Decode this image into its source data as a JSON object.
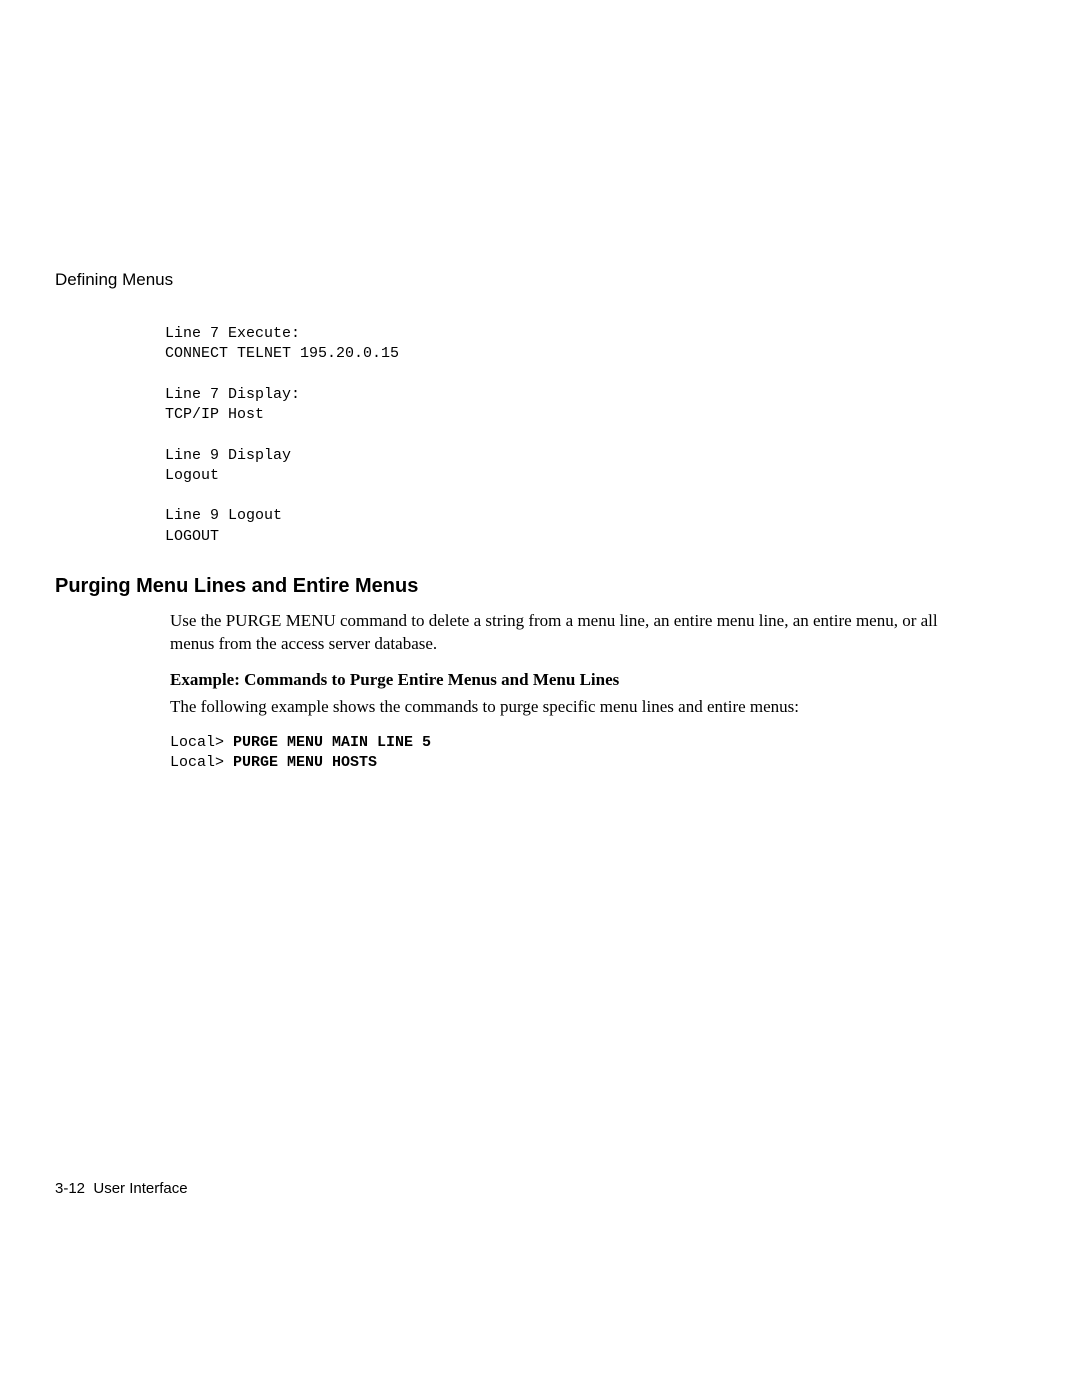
{
  "header": {
    "section_title": "Defining Menus"
  },
  "code_block": "Line 7 Execute:\nCONNECT TELNET 195.20.0.15\n\nLine 7 Display:\nTCP/IP Host\n\nLine 9 Display\nLogout\n\nLine 9 Logout\nLOGOUT",
  "heading": "Purging Menu Lines and Entire Menus",
  "paragraph_1": "Use the PURGE MENU command to delete a string from a menu line, an entire menu line, an entire menu, or all menus from the access server database.",
  "example_heading": "Example: Commands to Purge Entire Menus and Menu Lines",
  "paragraph_2": "The following example shows the commands to purge specific menu lines and entire menus:",
  "commands": {
    "line1_prompt": "Local> ",
    "line1_cmd": "PURGE MENU MAIN LINE 5",
    "line2_prompt": "Local> ",
    "line2_cmd": "PURGE MENU HOSTS"
  },
  "footer": {
    "page_number": "3-12",
    "page_label": "User Interface"
  }
}
